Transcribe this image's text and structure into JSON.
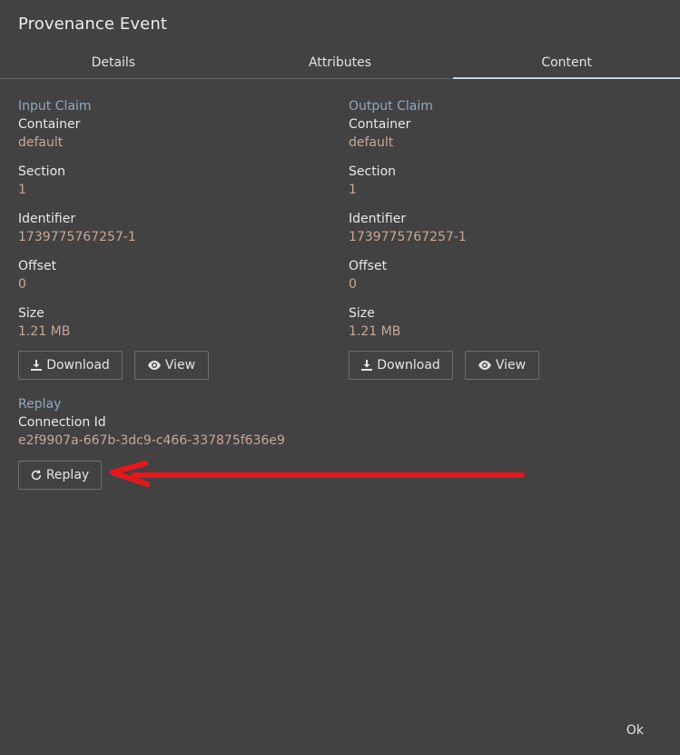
{
  "dialog": {
    "title": "Provenance Event",
    "ok_label": "Ok"
  },
  "tabs": [
    {
      "label": "Details",
      "active": false
    },
    {
      "label": "Attributes",
      "active": false
    },
    {
      "label": "Content",
      "active": true
    }
  ],
  "input_claim": {
    "heading": "Input Claim",
    "container_label": "Container",
    "container_value": "default",
    "section_label": "Section",
    "section_value": "1",
    "identifier_label": "Identifier",
    "identifier_value": "1739775767257-1",
    "offset_label": "Offset",
    "offset_value": "0",
    "size_label": "Size",
    "size_value": "1.21 MB",
    "download_label": "Download",
    "view_label": "View"
  },
  "output_claim": {
    "heading": "Output Claim",
    "container_label": "Container",
    "container_value": "default",
    "section_label": "Section",
    "section_value": "1",
    "identifier_label": "Identifier",
    "identifier_value": "1739775767257-1",
    "offset_label": "Offset",
    "offset_value": "0",
    "size_label": "Size",
    "size_value": "1.21 MB",
    "download_label": "Download",
    "view_label": "View"
  },
  "replay": {
    "heading": "Replay",
    "connection_label": "Connection Id",
    "connection_value": "e2f9907a-667b-3dc9-c466-337875f636e9",
    "button_label": "Replay"
  },
  "icons": {
    "download": "download-icon",
    "view": "eye-icon",
    "replay": "refresh-icon"
  },
  "colors": {
    "background": "#424242",
    "heading": "#8fa8bf",
    "value": "#c7a896",
    "annotation_arrow": "#e8161b"
  }
}
